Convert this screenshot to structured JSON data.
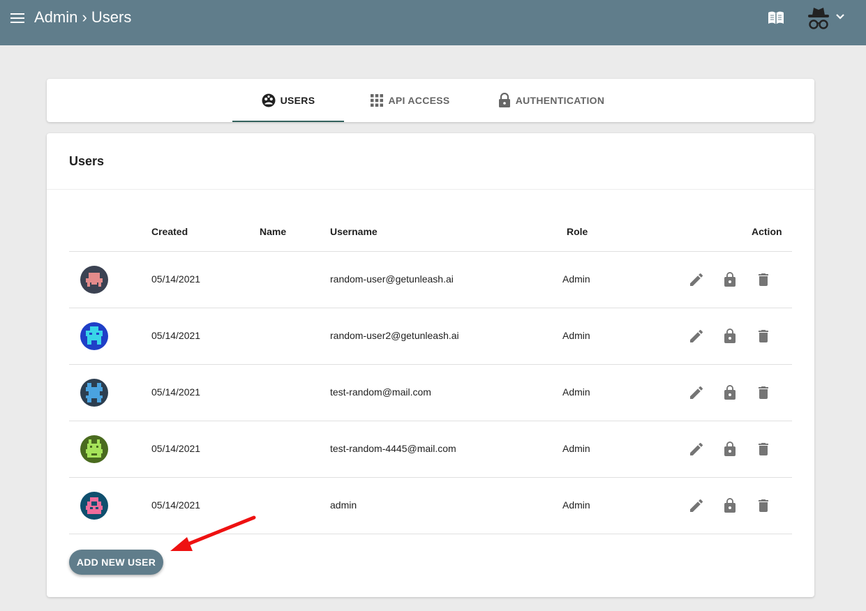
{
  "appbar": {
    "title": "Admin › Users",
    "icons": [
      "menu-icon",
      "book-icon",
      "incognito-user-icon",
      "chevron-down-icon"
    ],
    "color": "#607d8b"
  },
  "tabs": [
    {
      "label": "USERS",
      "icon": "user-circle-icon",
      "active": true
    },
    {
      "label": "API ACCESS",
      "icon": "grid-icon",
      "active": false
    },
    {
      "label": "AUTHENTICATION",
      "icon": "lock-icon",
      "active": false
    }
  ],
  "users_card": {
    "title": "Users",
    "columns": [
      "Created",
      "Name",
      "Username",
      "Role",
      "Action"
    ],
    "rows": [
      {
        "created": "05/14/2021",
        "name": "",
        "username": "random-user@getunleash.ai",
        "role": "Admin",
        "avatar_bg": "#3b4252",
        "avatar_fg": "#e38b8b"
      },
      {
        "created": "05/14/2021",
        "name": "",
        "username": "random-user2@getunleash.ai",
        "role": "Admin",
        "avatar_bg": "#1f3fc7",
        "avatar_fg": "#39d5e8"
      },
      {
        "created": "05/14/2021",
        "name": "",
        "username": "test-random@mail.com",
        "role": "Admin",
        "avatar_bg": "#2c3e50",
        "avatar_fg": "#4aa3e0"
      },
      {
        "created": "05/14/2021",
        "name": "",
        "username": "test-random-4445@mail.com",
        "role": "Admin",
        "avatar_bg": "#4a6b1f",
        "avatar_fg": "#a6e35a"
      },
      {
        "created": "05/14/2021",
        "name": "",
        "username": "admin",
        "role": "Admin",
        "avatar_bg": "#0f4f6e",
        "avatar_fg": "#f06c9b"
      }
    ],
    "row_actions": [
      "pencil-icon",
      "lock-icon",
      "trash-icon"
    ],
    "add_button": "ADD NEW USER"
  },
  "annotation": {
    "color": "#ee1111"
  }
}
